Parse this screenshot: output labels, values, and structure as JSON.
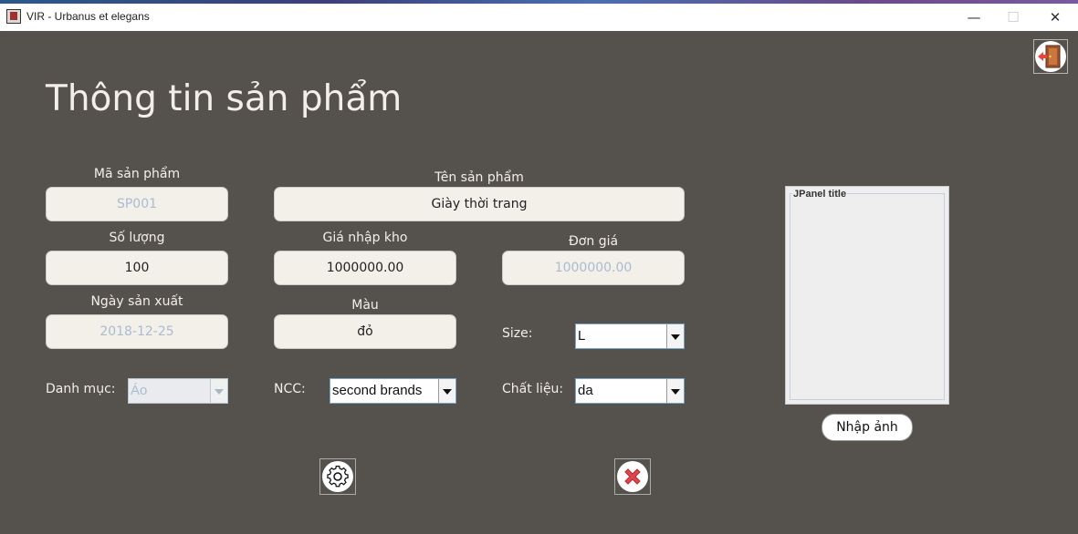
{
  "window": {
    "title": "VIR - Urbanus et elegans",
    "controls": {
      "minimize": "—",
      "maximize": "☐",
      "close": "✕"
    }
  },
  "header": {
    "title": "Thông tin sản phẩm",
    "exit_icon": "exit-door-icon"
  },
  "form": {
    "ma_sp": {
      "label": "Mã sản phẩm",
      "value": "SP001"
    },
    "ten_sp": {
      "label": "Tên sản phẩm",
      "value": "Giày thời trang"
    },
    "so_luong": {
      "label": "Số lượng",
      "value": "100"
    },
    "gia_nhap": {
      "label": "Giá nhập kho",
      "value": "1000000.00"
    },
    "don_gia": {
      "label": "Đơn giá",
      "value": "1000000.00"
    },
    "ngay_sx": {
      "label": "Ngày sản xuất",
      "value": "2018-12-25"
    },
    "mau": {
      "label": "Màu",
      "value": "đỏ"
    },
    "size": {
      "label": "Size:",
      "value": "L"
    },
    "danh_muc": {
      "label": "Danh mục:",
      "value": "Áo"
    },
    "ncc": {
      "label": "NCC:",
      "value": "second brands"
    },
    "chat_lieu": {
      "label": "Chất liệu:",
      "value": "da"
    }
  },
  "image_panel": {
    "title": "JPanel title",
    "button": "Nhập ảnh"
  },
  "actions": {
    "settings_icon": "gear-icon",
    "delete_icon": "red-x-icon"
  },
  "colors": {
    "background": "#55514c",
    "field": "#f3efe9",
    "label": "#f3eee8",
    "disabled_text": "#aabcd0",
    "delete": "#e0474c"
  }
}
